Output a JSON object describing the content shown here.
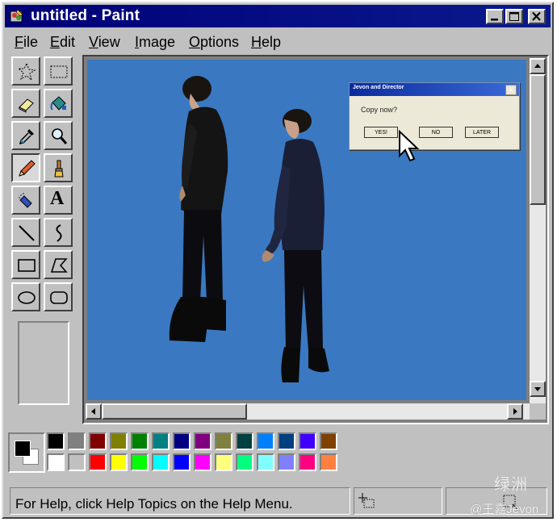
{
  "window": {
    "title": "untitled - Paint",
    "controls": [
      "minimize-icon",
      "maximize-icon",
      "close-icon"
    ]
  },
  "menu": [
    {
      "u": "F",
      "rest": "ile"
    },
    {
      "u": "E",
      "rest": "dit"
    },
    {
      "u": "V",
      "rest": "iew"
    },
    {
      "u": "I",
      "rest": "mage"
    },
    {
      "u": "O",
      "rest": "ptions"
    },
    {
      "u": "H",
      "rest": "elp"
    }
  ],
  "tools": [
    "free-select-icon",
    "rect-select-icon",
    "eraser-icon",
    "fill-bucket-icon",
    "color-picker-icon",
    "magnifier-icon",
    "pencil-icon",
    "brush-icon",
    "airbrush-icon",
    "text-icon",
    "line-icon",
    "curve-icon",
    "rectangle-icon",
    "polygon-icon",
    "ellipse-icon",
    "rounded-rect-icon"
  ],
  "active_tool": "pencil-icon",
  "text_tool_glyph": "A",
  "dialog": {
    "title": "Jevon and Director",
    "message": "Copy now?",
    "buttons": [
      "YES!",
      "NO",
      "LATER"
    ]
  },
  "palette": {
    "foreground": "#000000",
    "background": "#ffffff",
    "row1": [
      "#000000",
      "#808080",
      "#800000",
      "#808000",
      "#008000",
      "#008080",
      "#000080",
      "#800080",
      "#808040",
      "#004040",
      "#0080ff",
      "#004080",
      "#4000ff",
      "#804000"
    ],
    "row2": [
      "#ffffff",
      "#c0c0c0",
      "#ff0000",
      "#ffff00",
      "#00ff00",
      "#00ffff",
      "#0000ff",
      "#ff00ff",
      "#ffff80",
      "#00ff80",
      "#80ffff",
      "#8080ff",
      "#ff0080",
      "#ff8040"
    ]
  },
  "status": {
    "help_text": "For Help, click Help Topics on the Help Menu."
  },
  "watermark": {
    "logo": "绿洲",
    "handle": "@王嘉Jevon"
  }
}
